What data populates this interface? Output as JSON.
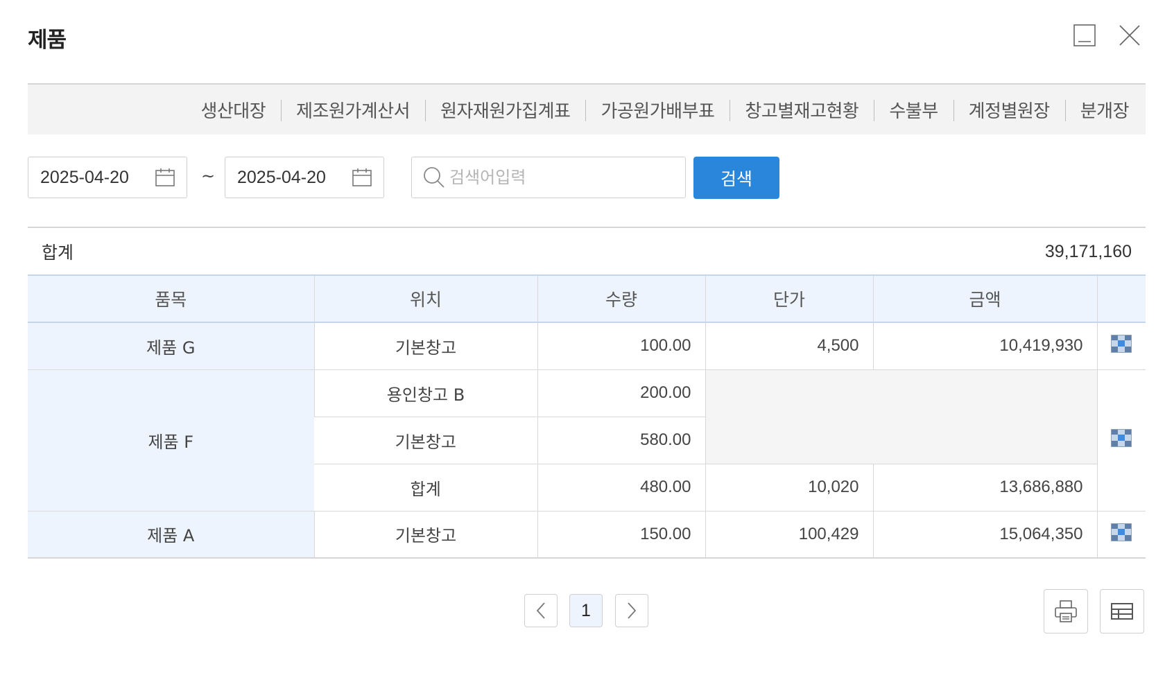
{
  "window": {
    "title": "제품",
    "minimize_icon": "minimize-icon",
    "close_icon": "close-icon"
  },
  "tabs": [
    "생산대장",
    "제조원가계산서",
    "원자재원가집계표",
    "가공원가배부표",
    "창고별재고현황",
    "수불부",
    "계정별원장",
    "분개장"
  ],
  "filters": {
    "date_from": "2025-04-20",
    "date_to": "2025-04-20",
    "separator": "~",
    "search_placeholder": "검색어입력",
    "search_value": "",
    "search_button": "검색"
  },
  "summary": {
    "label": "합계",
    "value": "39,171,160"
  },
  "table": {
    "headers": [
      "품목",
      "위치",
      "수량",
      "단가",
      "금액"
    ],
    "rows": [
      {
        "item": "제품 G",
        "entries": [
          {
            "location": "기본창고",
            "qty": "100.00",
            "unit_price": "4,500",
            "amount": "10,419,930"
          }
        ]
      },
      {
        "item": "제품 F",
        "entries": [
          {
            "location": "용인창고 B",
            "qty": "200.00",
            "unit_price": "",
            "amount": ""
          },
          {
            "location": "기본창고",
            "qty": "580.00",
            "unit_price": "",
            "amount": ""
          },
          {
            "location": "합계",
            "qty": "480.00",
            "unit_price": "10,020",
            "amount": "13,686,880"
          }
        ]
      },
      {
        "item": "제품 A",
        "entries": [
          {
            "location": "기본창고",
            "qty": "150.00",
            "unit_price": "100,429",
            "amount": "15,064,350"
          }
        ]
      }
    ]
  },
  "pagination": {
    "current_page": "1"
  },
  "colors": {
    "accent": "#2a86db",
    "header_bg": "#eef4fd",
    "tab_bg": "#f3f3f3"
  }
}
